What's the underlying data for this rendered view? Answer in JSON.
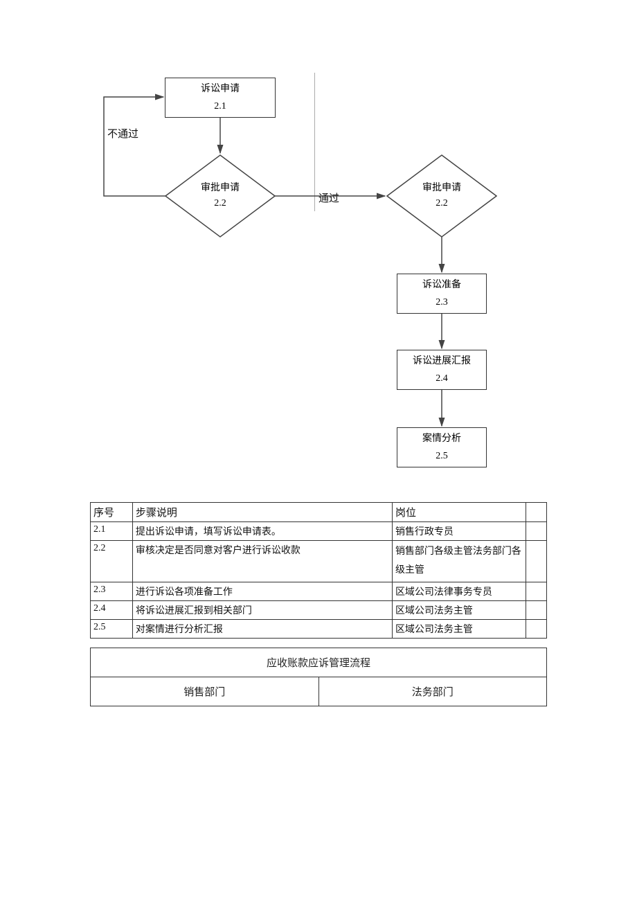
{
  "flow": {
    "node_2_1": {
      "title": "诉讼申请",
      "num": "2.1"
    },
    "node_2_2a": {
      "title": "审批申请",
      "num": "2.2"
    },
    "node_2_2b": {
      "title": "审批申请",
      "num": "2.2"
    },
    "node_2_3": {
      "title": "诉讼准备",
      "num": "2.3"
    },
    "node_2_4": {
      "title": "诉讼进展汇报",
      "num": "2.4"
    },
    "node_2_5": {
      "title": "案情分析",
      "num": "2.5"
    },
    "label_fail": "不通过",
    "label_pass": "通过"
  },
  "steps": {
    "headers": {
      "num": "序号",
      "desc": "步骤说明",
      "role": "岗位"
    },
    "rows": [
      {
        "num": "2.1",
        "desc": "提出诉讼申请，填写诉讼申请表。",
        "role": "销售行政专员"
      },
      {
        "num": "2.2",
        "desc": "审核决定是否同意对客户进行诉讼收款",
        "role": "销售部门各级主管法务部门各级主管"
      },
      {
        "num": "2.3",
        "desc": "进行诉讼各项准备工作",
        "role": "区域公司法律事务专员"
      },
      {
        "num": "2.4",
        "desc": "将诉讼进展汇报到相关部门",
        "role": "区域公司法务主管"
      },
      {
        "num": "2.5",
        "desc": "对案情进行分析汇报",
        "role": "区域公司法务主管"
      }
    ]
  },
  "depts": {
    "title": "应收账款应诉管理流程",
    "col1": "销售部门",
    "col2": "法务部门"
  }
}
